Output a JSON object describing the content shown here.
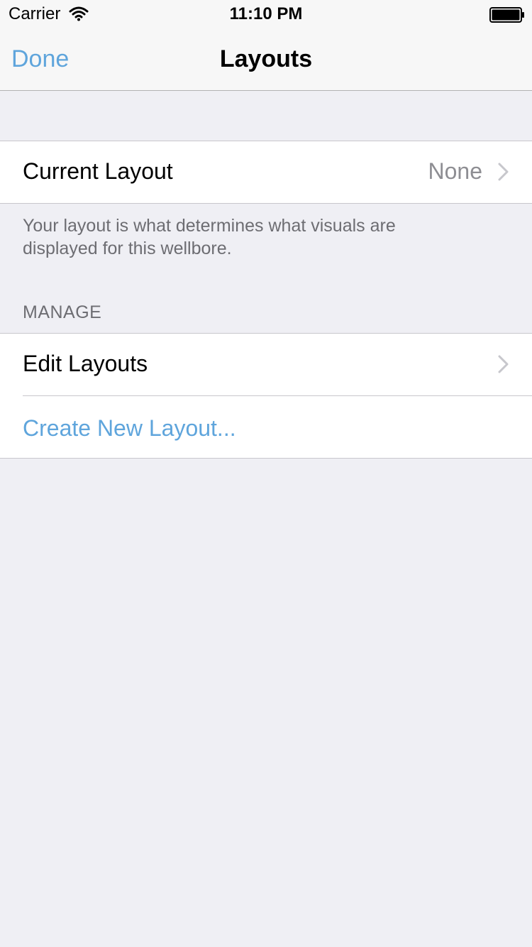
{
  "status_bar": {
    "carrier": "Carrier",
    "time": "11:10 PM"
  },
  "nav": {
    "done_label": "Done",
    "title": "Layouts"
  },
  "current_section": {
    "current_layout_label": "Current Layout",
    "current_layout_value": "None",
    "footer": "Your layout is what determines what visuals are displayed for this wellbore."
  },
  "manage_section": {
    "header": "MANAGE",
    "edit_label": "Edit Layouts",
    "create_label": "Create New Layout..."
  },
  "colors": {
    "tint": "#5fa5dc",
    "background": "#efeff4"
  },
  "icons": {
    "wifi": "wifi-icon",
    "battery": "battery-icon",
    "chevron": "chevron-right-icon"
  }
}
